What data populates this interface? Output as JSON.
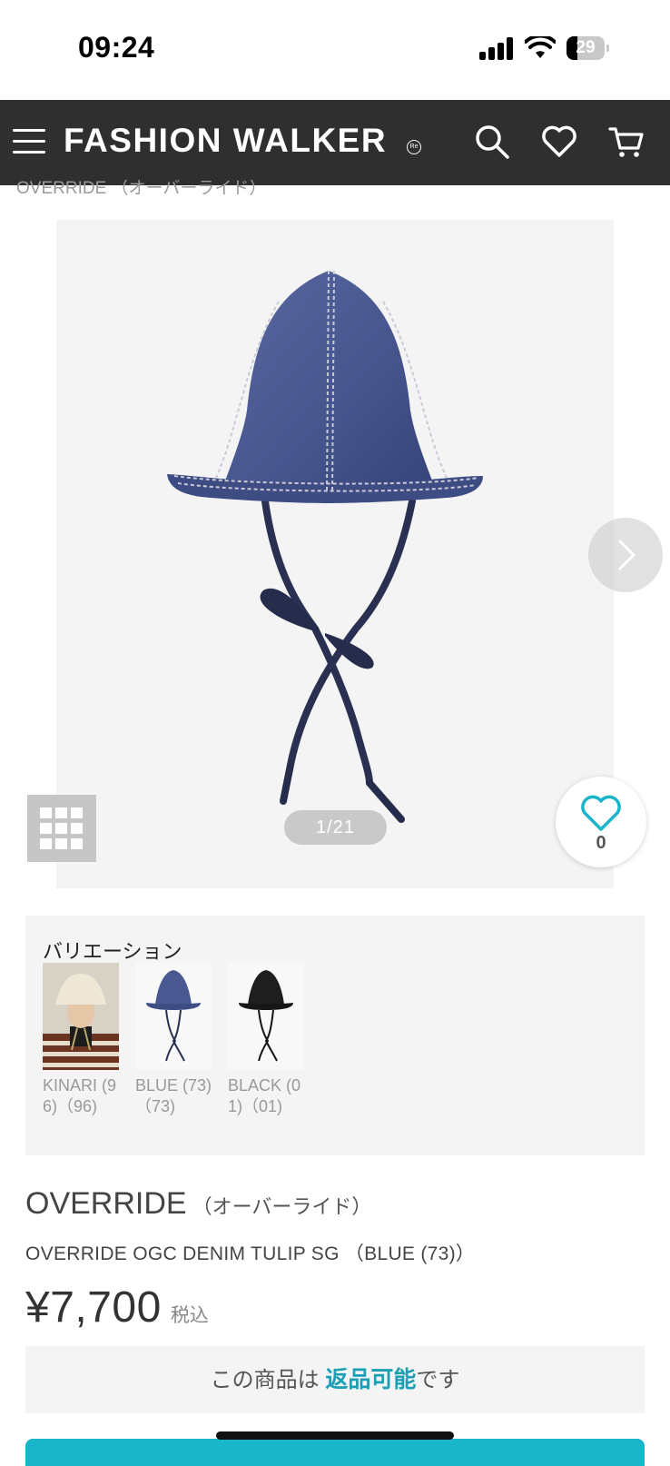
{
  "status_bar": {
    "time": "09:24",
    "battery": "29",
    "battery_level": 0.29
  },
  "header": {
    "logo": "FASHION WALKER",
    "logo_mark": "Re"
  },
  "breadcrumb": "OVERRIDE （オーバーライド）",
  "gallery": {
    "counter": "1/21"
  },
  "favorite": {
    "count": "0"
  },
  "variations": {
    "title": "バリエーション",
    "items": [
      {
        "label": "KINARI (96)（96)"
      },
      {
        "label": "BLUE (73)（73)"
      },
      {
        "label": "BLACK (01)（01)"
      }
    ]
  },
  "product": {
    "brand": "OVERRIDE",
    "brand_kana": "（オーバーライド）",
    "name": "OVERRIDE OGC DENIM TULIP SG （BLUE (73)）",
    "price": "¥7,700",
    "tax": "税込"
  },
  "returns": {
    "prefix": "この商品は ",
    "highlight": "返品可能",
    "suffix": "です"
  },
  "colors": {
    "header": "#2f2f2f",
    "accent": "#19b5c8",
    "heart": "#19b5c8"
  }
}
